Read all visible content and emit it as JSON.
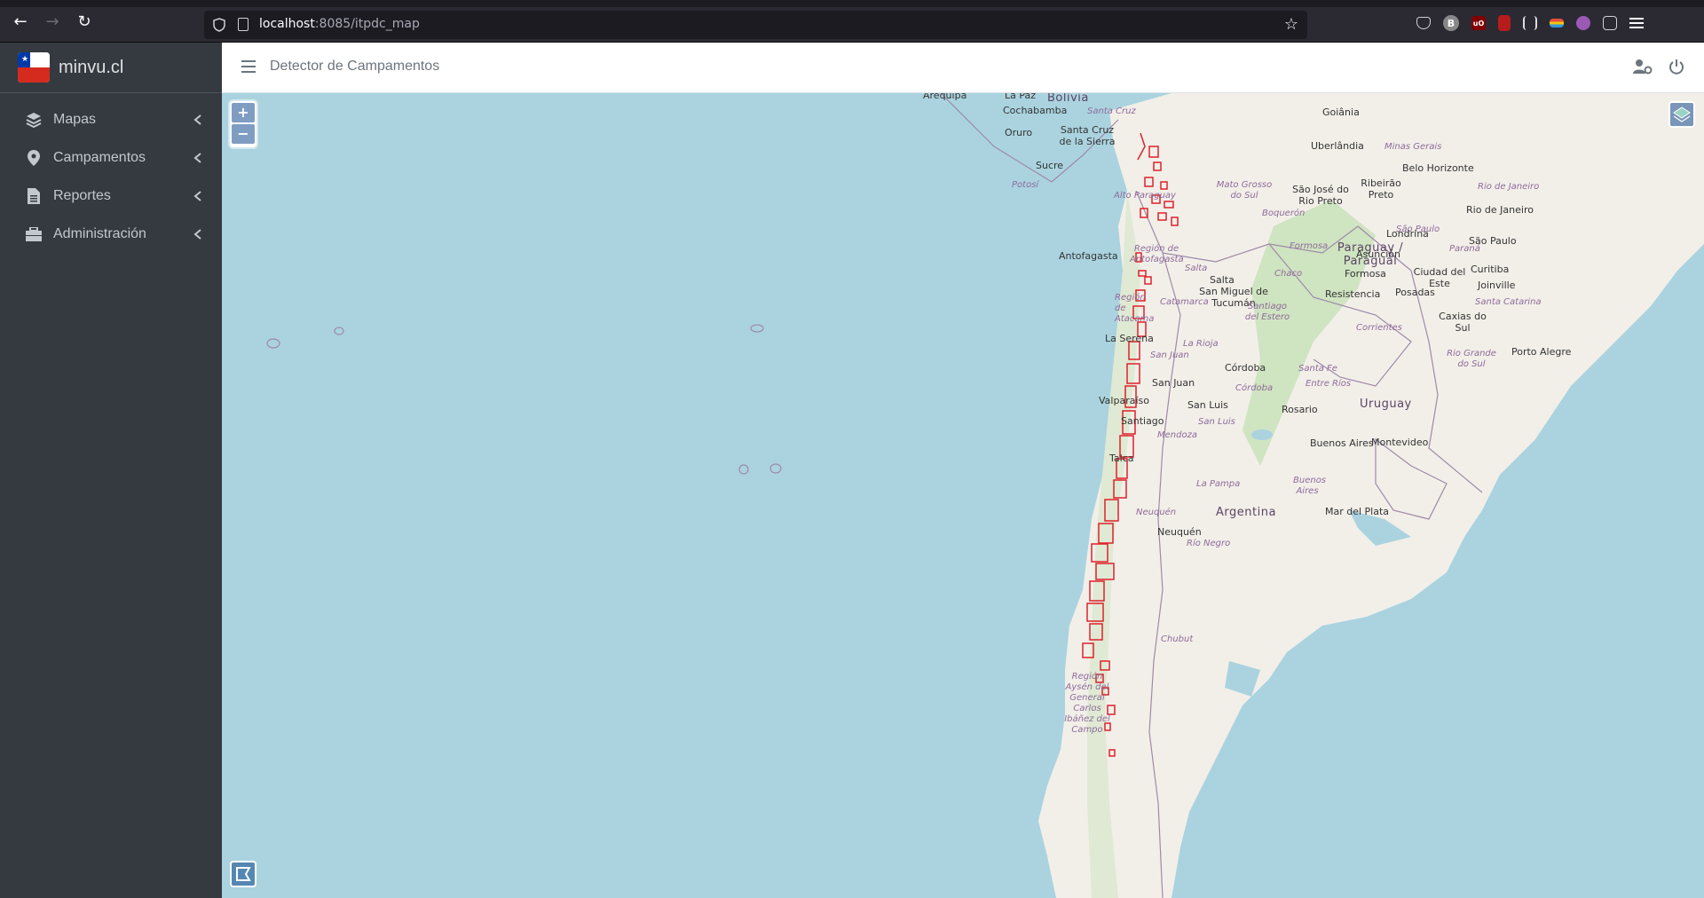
{
  "browser": {
    "url_host": "localhost",
    "url_path": ":8085/itpdc_map"
  },
  "brand": {
    "name": "minvu.cl"
  },
  "sidebar": {
    "items": [
      {
        "label": "Mapas",
        "icon": "layers-icon"
      },
      {
        "label": "Campamentos",
        "icon": "map-marker-icon"
      },
      {
        "label": "Reportes",
        "icon": "file-text-icon"
      },
      {
        "label": "Administración",
        "icon": "toolbox-icon"
      }
    ]
  },
  "topbar": {
    "title": "Detector de Campamentos"
  },
  "map": {
    "zoom_in": "+",
    "zoom_out": "−",
    "labels": {
      "countries": [
        "Bolivia",
        "Paraguay / Paraguái",
        "Argentina",
        "Uruguay"
      ],
      "cities": [
        "Arequipa",
        "La Paz",
        "Cochabamba",
        "Oruro",
        "Santa Cruz de la Sierra",
        "Sucre",
        "Goiânia",
        "Uberlândia",
        "Belo Horizonte",
        "São José do Rio Preto",
        "Ribeirão Preto",
        "Antofagasta",
        "Salta",
        "San Miguel de Tucumán",
        "Asunción",
        "Formosa",
        "Ciudad del Este",
        "Londrina",
        "São Paulo",
        "Rio de Janeiro",
        "Curitiba",
        "Joinville",
        "Resistencia",
        "Posadas",
        "Caxias do Sul",
        "Porto Alegre",
        "La Serena",
        "Córdoba",
        "San Juan",
        "Valparaíso",
        "Santiago",
        "San Luis",
        "Rosario",
        "Buenos Aires",
        "Montevideo",
        "Talca",
        "Mar del Plata",
        "Neuquén"
      ],
      "regions": [
        "Santa Cruz",
        "Minas Gerais",
        "Potosí",
        "Mato Grosso do Sul",
        "Alto Paraguay",
        "Boquerón",
        "Región de Antofagasta",
        "Salta",
        "Formosa",
        "Paraná",
        "Chaco",
        "Catamarca",
        "Santiago del Estero",
        "Corrientes",
        "Santa Catarina",
        "La Rioja",
        "San Juan",
        "Santa Fe",
        "Entre Ríos",
        "Rio Grande do Sul",
        "Córdoba",
        "San Luis",
        "Mendoza",
        "La Pampa",
        "Buenos Aires",
        "Neuquén",
        "Río Negro",
        "Chubut",
        "Región Aysén del General Carlos Ibáñez del Campo",
        "São Paulo",
        "Rio de Janeiro",
        "Región de Atacama"
      ]
    },
    "campamento_color": "#e0212b",
    "water_color": "#aad3df",
    "land_color": "#f2efe9"
  }
}
